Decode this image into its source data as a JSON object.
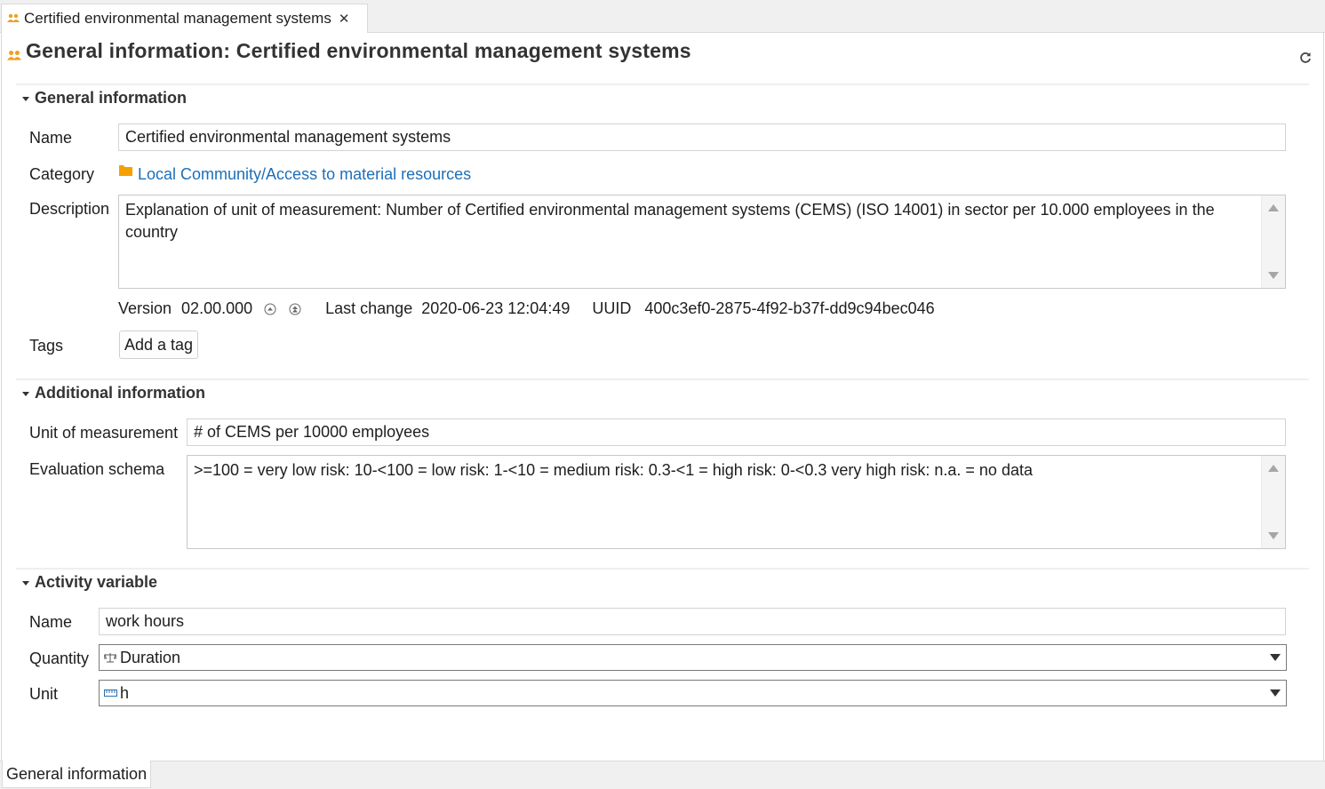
{
  "editor_tab": {
    "title": "Certified environmental management systems",
    "icon": "social-indicator-icon"
  },
  "page": {
    "title": "General information: Certified environmental management systems"
  },
  "general": {
    "heading": "General information",
    "name_label": "Name",
    "name_value": "Certified environmental management systems",
    "category_label": "Category",
    "category_value": "Local Community/Access to material resources",
    "description_label": "Description",
    "description_value": "Explanation of unit of measurement: Number of Certified environmental management systems (CEMS) (ISO 14001) in sector per 10.000 employees in the country",
    "version_label": "Version",
    "version_value": "02.00.000",
    "last_change_label": "Last change",
    "last_change_value": "2020-06-23 12:04:49",
    "uuid_label": "UUID",
    "uuid_value": "400c3ef0-2875-4f92-b37f-dd9c94bec046",
    "tags_label": "Tags",
    "add_tag_label": "Add a tag"
  },
  "additional": {
    "heading": "Additional information",
    "unit_label": "Unit of measurement",
    "unit_value": "# of CEMS per 10000 employees",
    "schema_label": "Evaluation schema",
    "schema_value": ">=100 = very low risk: 10-<100 = low risk: 1-<10 = medium risk: 0.3-<1 = high risk: 0-<0.3 very high risk: n.a. = no data"
  },
  "activity": {
    "heading": "Activity variable",
    "name_label": "Name",
    "name_value": "work hours",
    "quantity_label": "Quantity",
    "quantity_value": "Duration",
    "unit_label": "Unit",
    "unit_value": "h"
  },
  "bottom_tab": {
    "label": "General information"
  },
  "colors": {
    "link": "#1d6fb8",
    "folder": "#f5a000",
    "icon_orange": "#f0a020"
  }
}
